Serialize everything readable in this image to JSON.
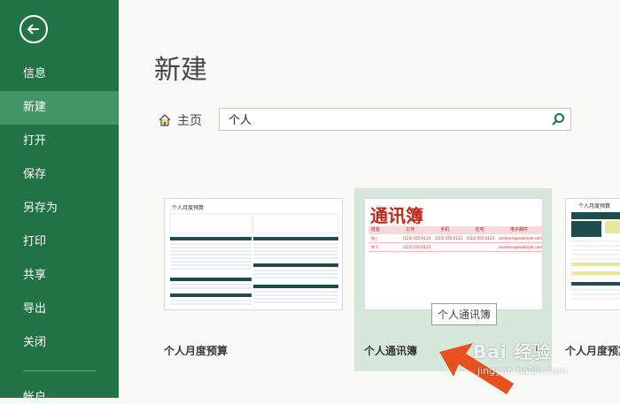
{
  "sidebar": {
    "items": [
      {
        "label": "信息"
      },
      {
        "label": "新建"
      },
      {
        "label": "打开"
      },
      {
        "label": "保存"
      },
      {
        "label": "另存为"
      },
      {
        "label": "打印"
      },
      {
        "label": "共享"
      },
      {
        "label": "导出"
      },
      {
        "label": "关闭"
      }
    ],
    "active_index": 1,
    "bottom_label": "帐户"
  },
  "main": {
    "title": "新建",
    "home_label": "主页",
    "search_value": "个人"
  },
  "templates": [
    {
      "label": "个人月度预算",
      "preview_title": "个人月度预算"
    },
    {
      "label": "个人通讯簿",
      "preview_title": "通讯簿",
      "columns": [
        "姓名",
        "工作",
        "手机",
        "住宅",
        "电子邮件"
      ],
      "rows": [
        [
          "张三",
          "(123) 555-0123",
          "(123) 555-0123",
          "(123) 555-0123",
          "someone@example.com"
        ],
        [
          "李飞",
          "(123) 555-0123",
          "",
          "",
          "someone@example.com"
        ]
      ]
    },
    {
      "label": "个人月度预算",
      "preview_title": "个人月度预算"
    }
  ],
  "tooltip": "个人通讯簿",
  "watermark": {
    "main": "Bai 经验",
    "sub": "jingyan.baidu.com"
  },
  "colors": {
    "sidebar": "#217346",
    "active": "#439467",
    "accent": "#c0281d",
    "hover": "#d5e8db"
  }
}
